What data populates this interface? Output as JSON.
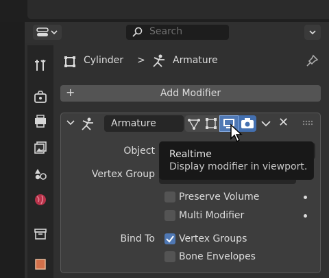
{
  "header": {
    "search_placeholder": "Search",
    "editor_type_icon": "properties-editor-icon",
    "options_icon": "chevron-down-icon"
  },
  "tabs": [
    {
      "name": "tool",
      "icon": "wrench-screwdriver-icon"
    },
    {
      "name": "render",
      "icon": "camera-back-icon"
    },
    {
      "name": "output",
      "icon": "printer-icon"
    },
    {
      "name": "view-layer",
      "icon": "image-stack-icon"
    },
    {
      "name": "scene",
      "icon": "scene-icon"
    },
    {
      "name": "world",
      "icon": "globe-icon"
    },
    {
      "name": "collection",
      "icon": "box-icon"
    },
    {
      "name": "object",
      "icon": "object-square-icon"
    }
  ],
  "breadcrumb": {
    "object": "Cylinder",
    "separator": ">",
    "modifier": "Armature"
  },
  "add_modifier": {
    "plus": "+",
    "label": "Add Modifier"
  },
  "modifier": {
    "name": "Armature",
    "remove": "✕",
    "labels": {
      "object": "Object",
      "vertex_group": "Vertex Group",
      "bind_to": "Bind To"
    },
    "checkboxes": [
      {
        "label": "Preserve Volume",
        "checked": false
      },
      {
        "label": "Multi Modifier",
        "checked": false
      },
      {
        "label": "Vertex Groups",
        "checked": true
      },
      {
        "label": "Bone Envelopes",
        "checked": false
      }
    ]
  },
  "tooltip": {
    "title": "Realtime",
    "description": "Display modifier in viewport."
  },
  "colors": {
    "accent": "#4f78b4",
    "panel": "#3d3d3d",
    "field": "#262626"
  }
}
